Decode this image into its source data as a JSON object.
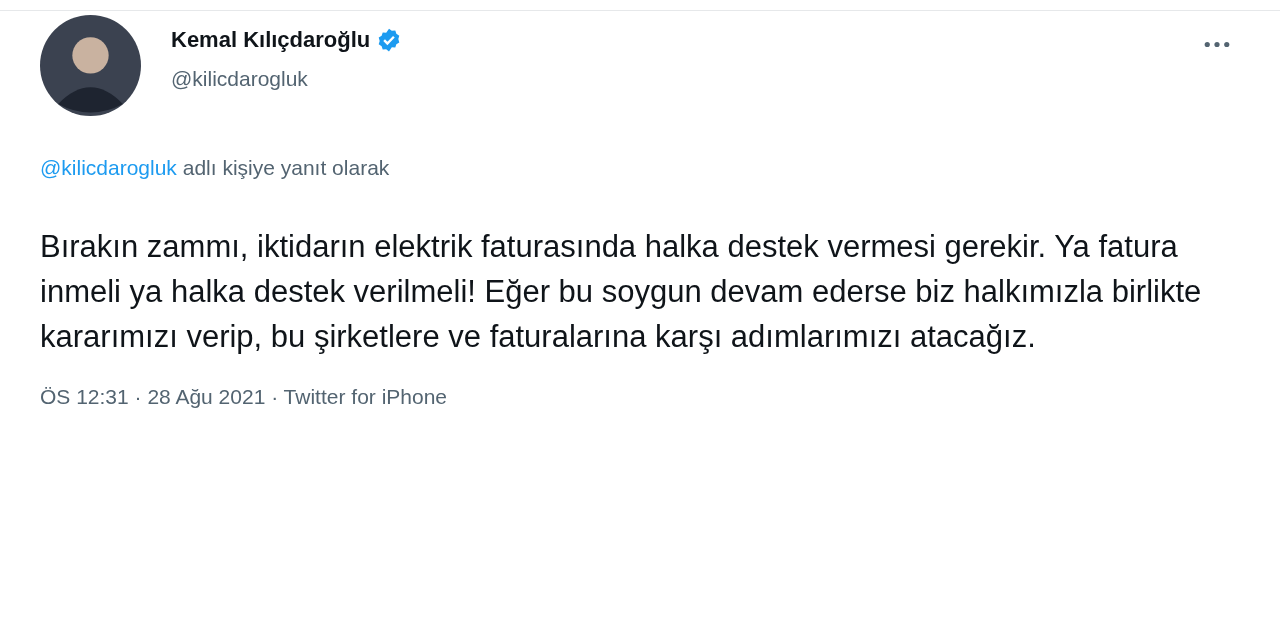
{
  "author": {
    "name": "Kemal Kılıçdaroğlu",
    "handle": "@kilicdarogluk",
    "verified": true
  },
  "reply_context": {
    "mention": "@kilicdarogluk",
    "text": "adlı kişiye yanıt olarak"
  },
  "tweet": {
    "text": "Bırakın zammı, iktidarın elektrik faturasında halka destek vermesi gerekir. Ya fatura inmeli ya halka destek verilmeli! Eğer bu soygun devam ederse biz halkımızla birlikte kararımızı verip, bu şirketlere ve faturalarına karşı adımlarımızı atacağız."
  },
  "meta": "ÖS 12:31 · 28 Ağu 2021 · Twitter for iPhone"
}
